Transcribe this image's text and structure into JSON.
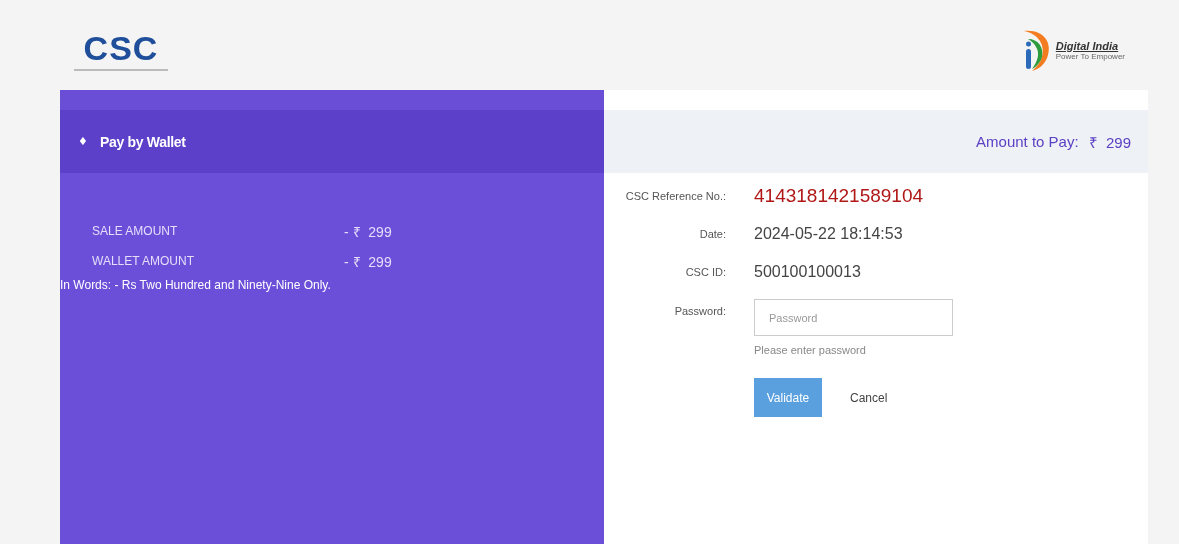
{
  "header": {
    "logo_text": "CSC",
    "brand_title": "Digital India",
    "brand_tagline": "Power To Empower"
  },
  "left": {
    "bullet": "♦",
    "title": "Pay by Wallet",
    "amounts": [
      {
        "label": "SALE AMOUNT",
        "value": "- ₹  299"
      },
      {
        "label": "WALLET AMOUNT",
        "value": "- ₹  299"
      }
    ],
    "in_words": "In Words: - Rs Two Hundred and Ninety-Nine Only."
  },
  "right": {
    "amount_label": "Amount to Pay:",
    "amount_value": "₹  299",
    "fields": [
      {
        "kind": "highlight",
        "label": "CSC Reference No.:",
        "value": "4143181421589104"
      },
      {
        "kind": "text",
        "label": "Date:",
        "value": "2024-05-22 18:14:53"
      },
      {
        "kind": "text",
        "label": "CSC ID:",
        "value": "500100100013"
      }
    ],
    "password": {
      "label": "Password:",
      "placeholder": "Password",
      "hint": "Please enter password"
    },
    "buttons": [
      {
        "kind": "primary",
        "label": "Validate"
      },
      {
        "kind": "link",
        "label": "Cancel"
      }
    ]
  }
}
